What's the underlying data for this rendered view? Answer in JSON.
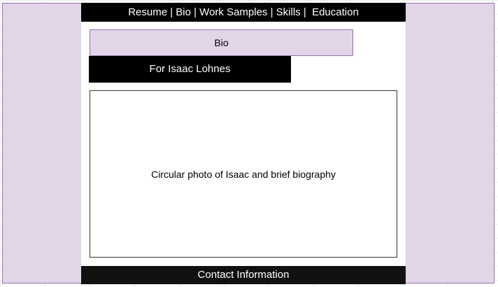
{
  "nav": {
    "text": "Resume | Bio | Work Samples | Skills |  Education"
  },
  "bio_header": {
    "label": "Bio"
  },
  "subtitle": {
    "text": "For Isaac Lohnes"
  },
  "content": {
    "placeholder_text": "Circular photo of Isaac and brief biography"
  },
  "footer": {
    "text": "Contact Information"
  },
  "colors": {
    "panel_fill": "#e1d5e7",
    "panel_border": "#9673a6",
    "bar_fill": "#000000",
    "bar_text": "#ffffff"
  }
}
